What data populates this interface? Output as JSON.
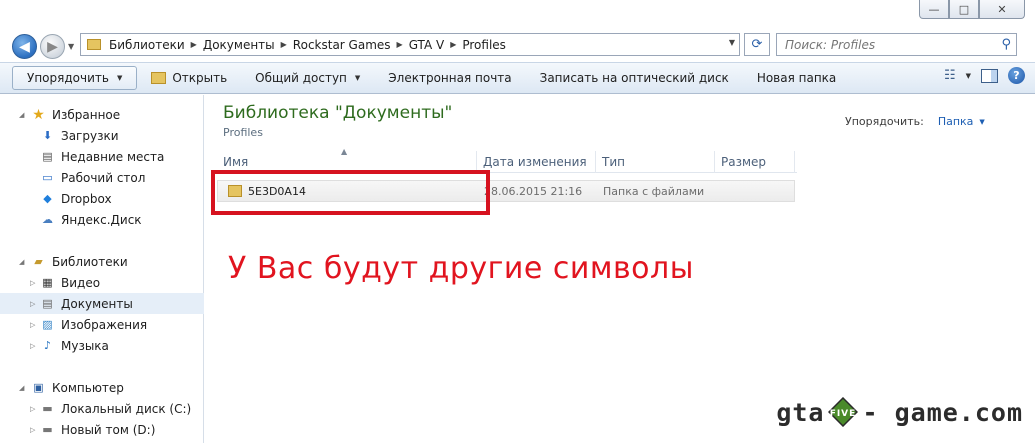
{
  "window": {
    "minimize": "—",
    "maximize": "□",
    "close": "✕"
  },
  "address": {
    "crumbs": [
      "Библиотеки",
      "Документы",
      "Rockstar Games",
      "GTA V",
      "Profiles"
    ],
    "search_placeholder": "Поиск: Profiles"
  },
  "toolbar": {
    "organize": "Упорядочить",
    "open": "Открыть",
    "share": "Общий доступ",
    "email": "Электронная почта",
    "burn": "Записать на оптический диск",
    "new_folder": "Новая папка"
  },
  "sidebar": {
    "favorites": "Избранное",
    "downloads": "Загрузки",
    "recent": "Недавние места",
    "desktop": "Рабочий стол",
    "dropbox": "Dropbox",
    "yadisk": "Яндекс.Диск",
    "libraries": "Библиотеки",
    "video": "Видео",
    "documents": "Документы",
    "images": "Изображения",
    "music": "Музыка",
    "computer": "Компьютер",
    "disk_c": "Локальный диск (C:)",
    "disk_d": "Новый том (D:)"
  },
  "content": {
    "library_title": "Библиотека \"Документы\"",
    "library_subtitle": "Profiles",
    "arrange_label": "Упорядочить:",
    "arrange_value": "Папка",
    "columns": {
      "name": "Имя",
      "date": "Дата изменения",
      "type": "Тип",
      "size": "Размер"
    },
    "file": {
      "name": "5E3D0A14",
      "date": "28.06.2015 21:16",
      "type": "Папка с файлами"
    },
    "annotation": "У Вас будут другие символы",
    "annotation_color": "#e1141f"
  },
  "watermark": {
    "left": "gta",
    "right": "- game.com"
  }
}
